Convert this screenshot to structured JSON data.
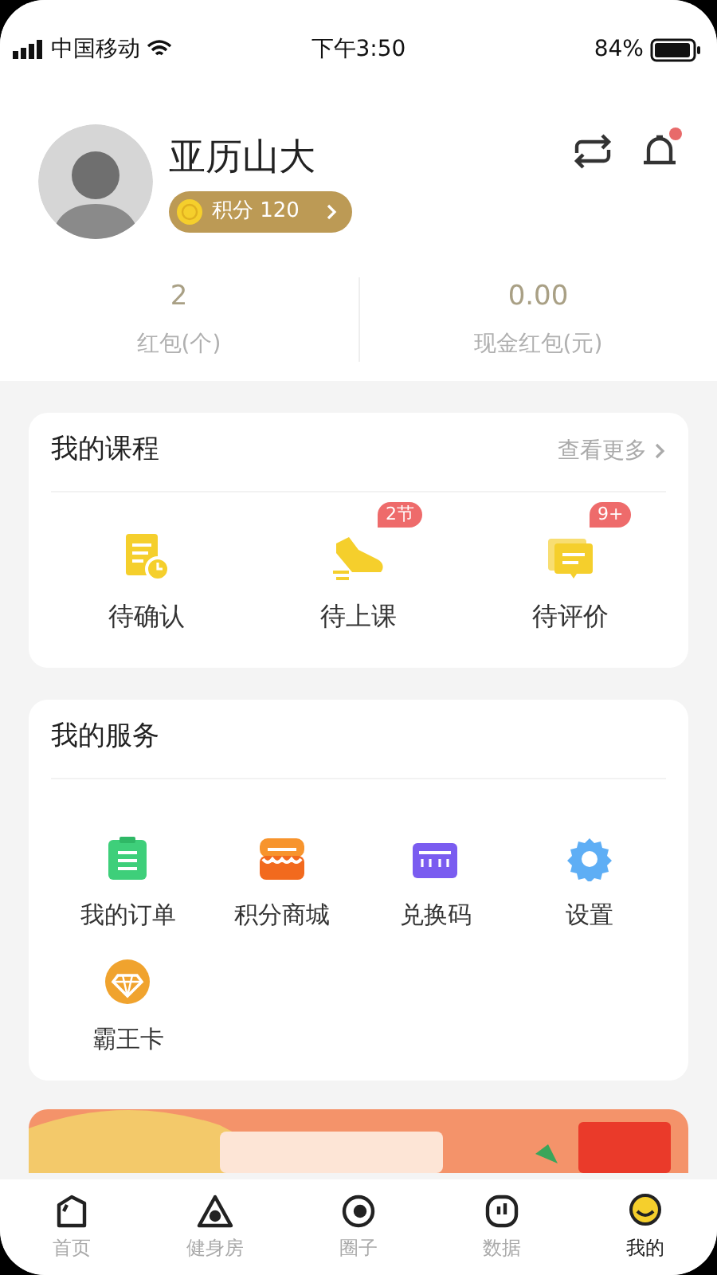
{
  "status_bar": {
    "carrier": "中国移动",
    "time": "下午3:50",
    "battery": "84%"
  },
  "profile": {
    "name": "亚历山大",
    "points_badge": "积分 120",
    "notification_dot": true
  },
  "stats": [
    {
      "value": "2",
      "label": "红包(个)"
    },
    {
      "value": "0.00",
      "label": "现金红包(元)"
    }
  ],
  "courses": {
    "title": "我的课程",
    "more": "查看更多",
    "items": [
      {
        "kind": "confirm",
        "label": "待确认"
      },
      {
        "kind": "class",
        "label": "待上课",
        "badge": "2节"
      },
      {
        "kind": "review",
        "label": "待评价",
        "badge": "9+"
      }
    ]
  },
  "services": {
    "title": "我的服务",
    "items": [
      {
        "kind": "orders",
        "label": "我的订单"
      },
      {
        "kind": "shop",
        "label": "积分商城"
      },
      {
        "kind": "code",
        "label": "兑换码"
      },
      {
        "kind": "settings",
        "label": "设置"
      },
      {
        "kind": "vip",
        "label": "霸王卡"
      }
    ]
  },
  "tab_bar": [
    {
      "kind": "home",
      "label": "首页",
      "selected": false
    },
    {
      "kind": "gym",
      "label": "健身房",
      "selected": false
    },
    {
      "kind": "circle",
      "label": "圈子",
      "selected": false
    },
    {
      "kind": "data",
      "label": "数据",
      "selected": false
    },
    {
      "kind": "me",
      "label": "我的",
      "selected": true
    }
  ]
}
